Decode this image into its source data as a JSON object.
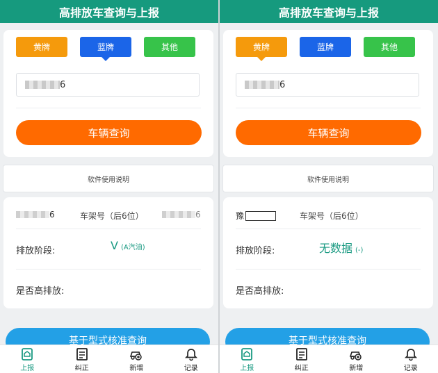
{
  "screens": [
    {
      "header": {
        "title": "高排放车查询与上报"
      },
      "plates": {
        "yellow": "黄牌",
        "blue": "蓝牌",
        "other": "其他",
        "active": "blue"
      },
      "plate_input": {
        "value_suffix": "6"
      },
      "query_button": "车辆查询",
      "help_link": "软件使用说明",
      "info": {
        "plate_suffix": "6",
        "vin_label": "车架号（后6位）",
        "vin_suffix": "6",
        "stage_label": "排放阶段:",
        "stage_value": "V",
        "stage_sub": "(A汽油)",
        "high_label": "是否高排放:"
      },
      "bottom_button": "基于型式核准查询",
      "tabs": [
        {
          "label": "上报",
          "icon": "report-icon",
          "active": true
        },
        {
          "label": "纠正",
          "icon": "correct-icon",
          "active": false
        },
        {
          "label": "新增",
          "icon": "add-vehicle-icon",
          "active": false
        },
        {
          "label": "记录",
          "icon": "bell-icon",
          "active": false
        }
      ]
    },
    {
      "header": {
        "title": "高排放车查询与上报"
      },
      "plates": {
        "yellow": "黄牌",
        "blue": "蓝牌",
        "other": "其他",
        "active": "yellow"
      },
      "plate_input": {
        "value_suffix": "6"
      },
      "query_button": "车辆查询",
      "help_link": "软件使用说明",
      "info": {
        "plate_prefix": "豫",
        "vin_label": "车架号（后6位）",
        "stage_label": "排放阶段:",
        "stage_value": "无数据",
        "stage_sub": "(-)",
        "high_label": "是否高排放:"
      },
      "bottom_button": "基于型式核准查询",
      "tabs": [
        {
          "label": "上报",
          "icon": "report-icon",
          "active": true
        },
        {
          "label": "纠正",
          "icon": "correct-icon",
          "active": false
        },
        {
          "label": "新增",
          "icon": "add-vehicle-icon",
          "active": false
        },
        {
          "label": "记录",
          "icon": "bell-icon",
          "active": false
        }
      ]
    }
  ],
  "colors": {
    "header": "#169a7e",
    "accent": "#ff6a00",
    "active_tab": "#1a9a82"
  }
}
